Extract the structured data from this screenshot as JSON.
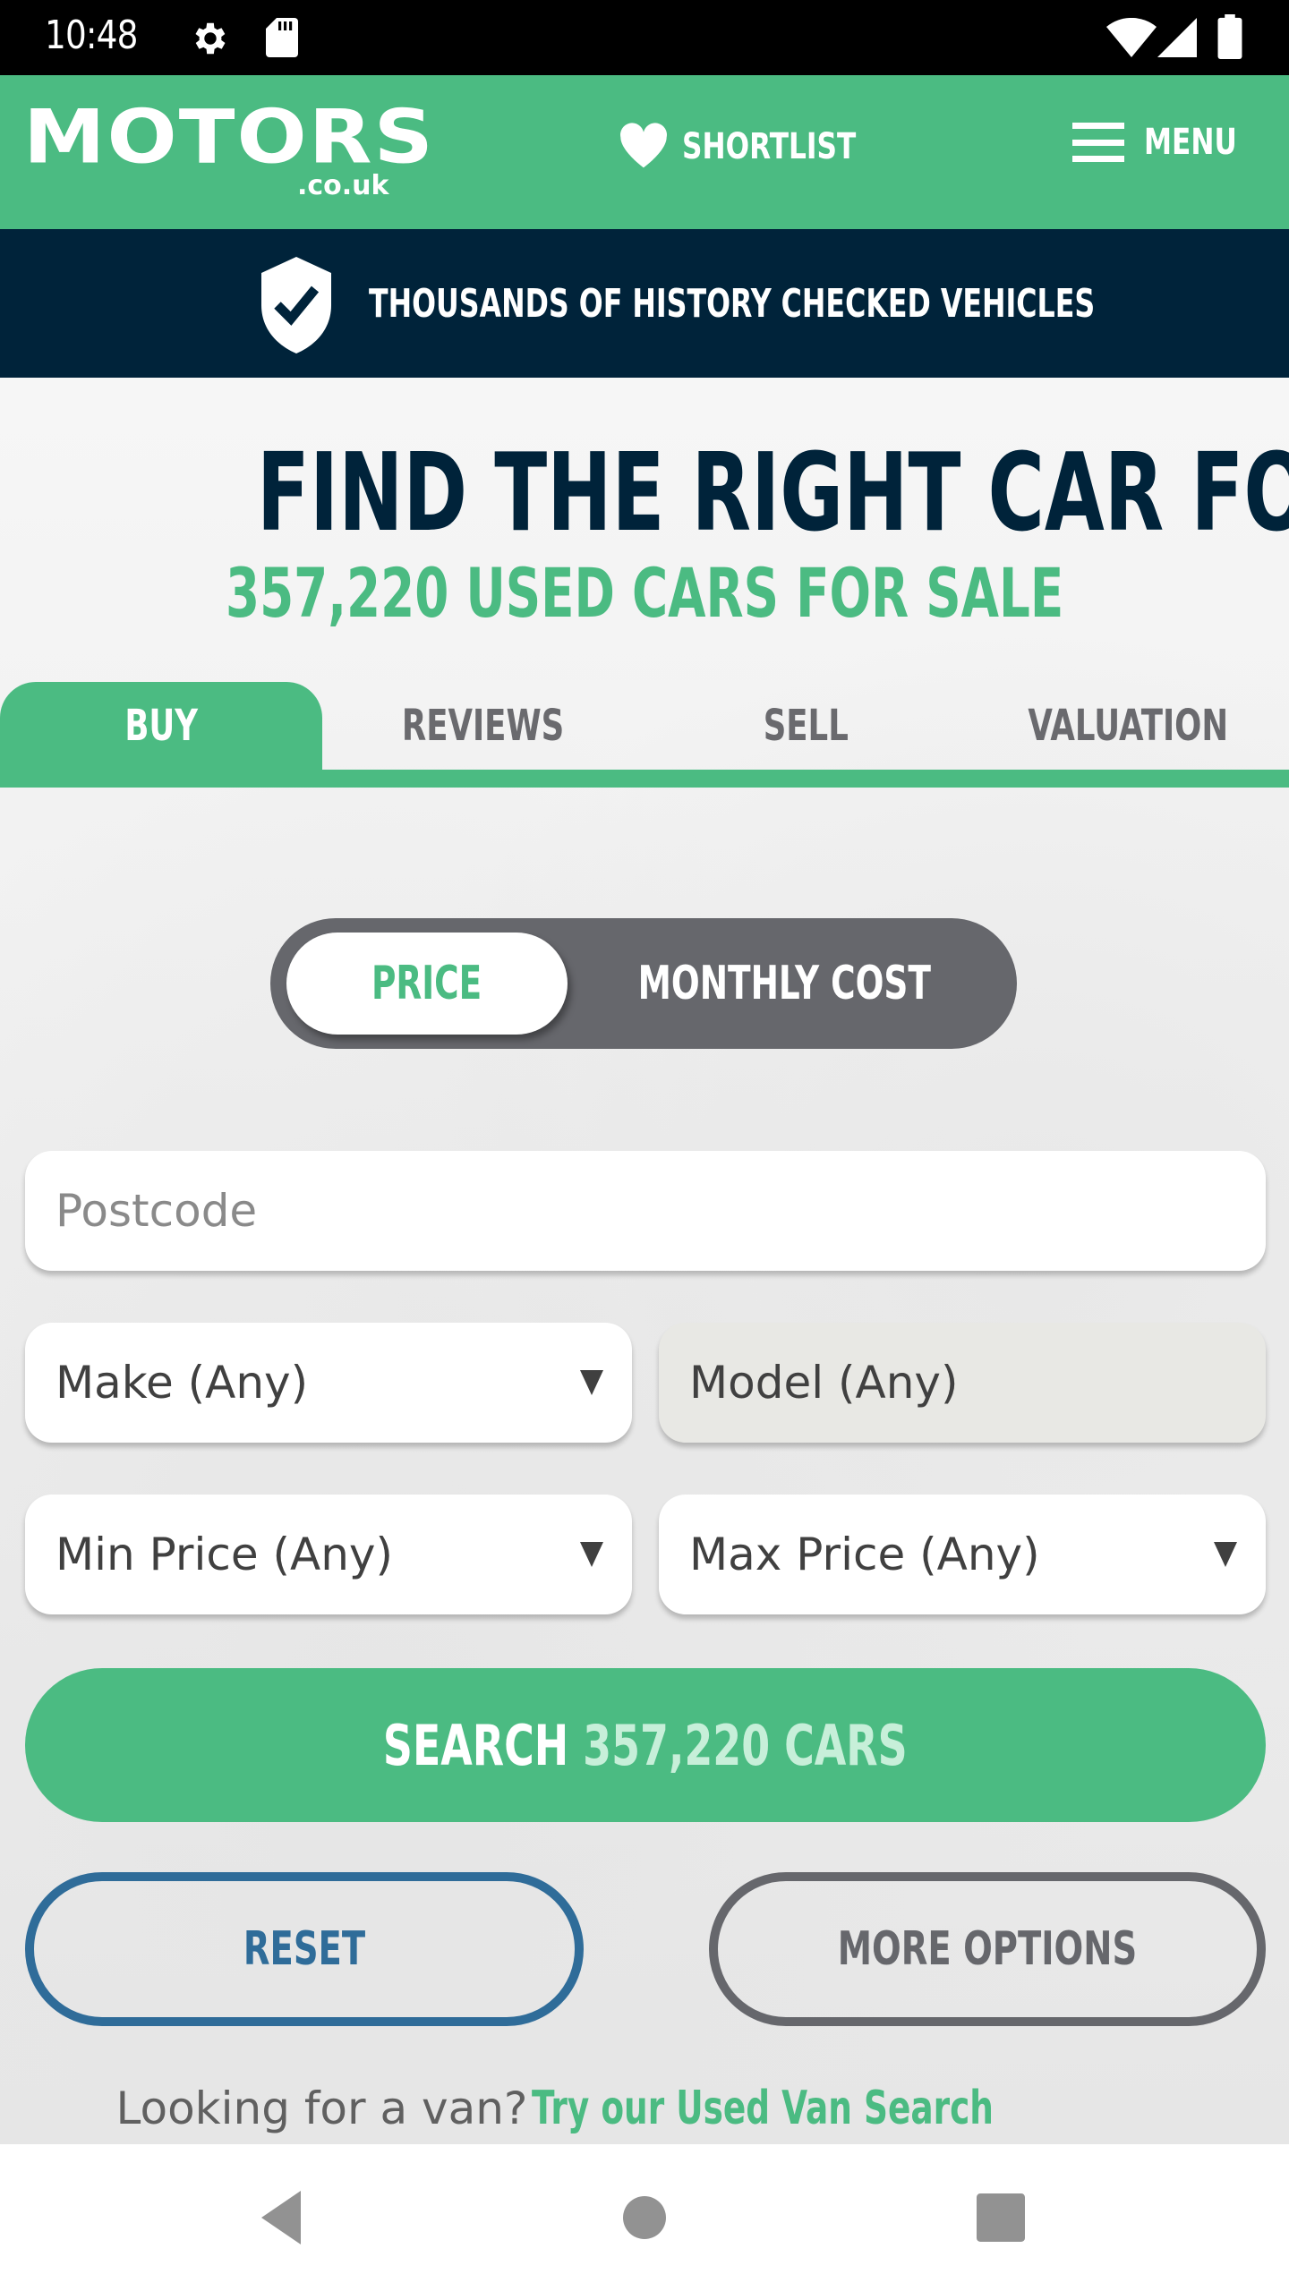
{
  "status_bar": {
    "time": "10:48",
    "left_icons": [
      "gear-icon",
      "sd-card-icon"
    ],
    "right_icons": [
      "wifi-icon",
      "cell-signal-icon",
      "battery-icon"
    ]
  },
  "header": {
    "logo_text": "MOTORS",
    "logo_tld": ".co.uk",
    "shortlist_label": "SHORTLIST",
    "menu_label": "MENU",
    "brand_color": "#4bbb82"
  },
  "banner": {
    "text": "THOUSANDS OF HISTORY CHECKED VEHICLES",
    "icon": "shield-check-icon",
    "background": "#00233a"
  },
  "hero": {
    "title": "FIND THE RIGHT CAR FOR YOU",
    "subtitle": "357,220 USED CARS FOR SALE"
  },
  "tabs": [
    {
      "label": "BUY",
      "active": true
    },
    {
      "label": "REVIEWS",
      "active": false
    },
    {
      "label": "SELL",
      "active": false
    },
    {
      "label": "VALUATION",
      "active": false
    }
  ],
  "price_toggle": {
    "options": [
      "PRICE",
      "MONTHLY COST"
    ],
    "selected": "PRICE"
  },
  "form": {
    "postcode_placeholder": "Postcode",
    "make": "Make (Any)",
    "model": "Model (Any)",
    "min_price": "Min Price (Any)",
    "max_price": "Max Price (Any)"
  },
  "actions": {
    "search_prefix": "SEARCH",
    "search_count": "357,220 CARS",
    "reset_label": "RESET",
    "more_options_label": "MORE OPTIONS"
  },
  "van_prompt": {
    "question": "Looking for a van?",
    "link": "Try our Used Van Search"
  },
  "nav_bar": {
    "buttons": [
      "back-icon",
      "home-icon",
      "recents-icon"
    ]
  }
}
